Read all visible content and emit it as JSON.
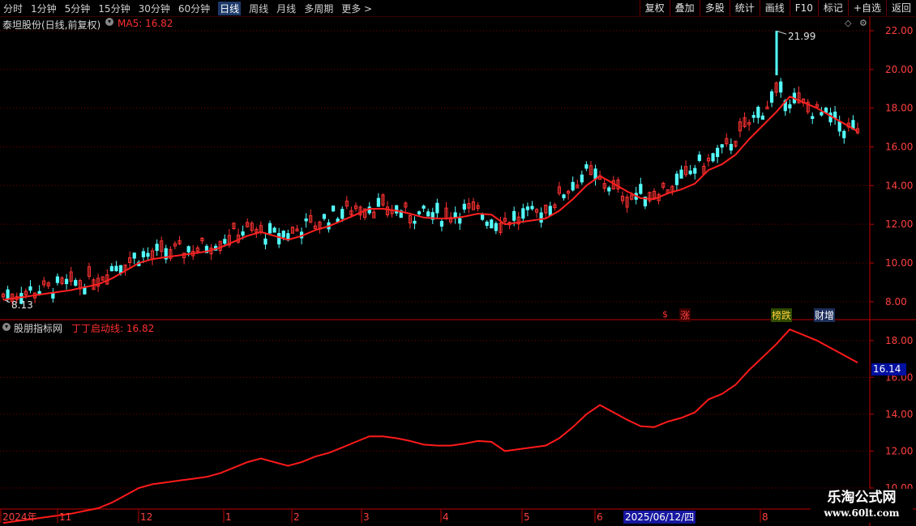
{
  "toolbar": {
    "periods": [
      {
        "label": "分时",
        "active": false
      },
      {
        "label": "1分钟",
        "active": false
      },
      {
        "label": "5分钟",
        "active": false
      },
      {
        "label": "15分钟",
        "active": false
      },
      {
        "label": "30分钟",
        "active": false
      },
      {
        "label": "60分钟",
        "active": false
      },
      {
        "label": "日线",
        "active": true
      },
      {
        "label": "周线",
        "active": false
      },
      {
        "label": "月线",
        "active": false
      },
      {
        "label": "多周期",
        "active": false
      },
      {
        "label": "更多",
        "active": false
      }
    ],
    "tools": [
      "复权",
      "叠加",
      "多股",
      "统计",
      "画线",
      "F10",
      "标记",
      "+自选",
      "返回"
    ]
  },
  "main_panel": {
    "title": "泰坦股份(日线,前复权)",
    "indicator_name": "MA5:",
    "indicator_value": "16.82",
    "high_label": "21.99",
    "low_label": "8.13",
    "markers": [
      "$",
      "涨",
      "榜跌",
      "财增"
    ]
  },
  "sub_panel": {
    "title": "股朋指标网",
    "indicator_name": "丁丁启动线:",
    "indicator_value": "16.82",
    "current_value_box": "16.14"
  },
  "date_axis": {
    "labels": [
      "2024年",
      "11",
      "12",
      "1",
      "2",
      "3",
      "4",
      "5",
      "6",
      "8"
    ],
    "crosshair_label": "2025/06/12/四"
  },
  "watermark": {
    "line1": "乐淘公式网",
    "line2": "www.60lt.com"
  },
  "colors": {
    "up": "#ff3232",
    "down": "#54ffff",
    "ma": "#ff2020",
    "grid": "#7a0000",
    "axis_text": "#ff4040"
  },
  "chart_data": [
    {
      "type": "candlestick",
      "name": "main",
      "y_ticks": [
        8.0,
        10.0,
        12.0,
        14.0,
        16.0,
        18.0,
        20.0,
        22.0
      ],
      "ylim": [
        7.2,
        22.5
      ],
      "ma5_series": [
        8.1,
        8.2,
        8.3,
        8.4,
        8.5,
        8.6,
        8.75,
        8.9,
        9.2,
        9.6,
        10.0,
        10.2,
        10.3,
        10.4,
        10.5,
        10.6,
        10.8,
        11.1,
        11.4,
        11.6,
        11.4,
        11.2,
        11.4,
        11.7,
        11.9,
        12.2,
        12.5,
        12.8,
        12.8,
        12.7,
        12.55,
        12.35,
        12.3,
        12.3,
        12.4,
        12.55,
        12.5,
        12.0,
        12.1,
        12.2,
        12.3,
        12.7,
        13.3,
        14.0,
        14.5,
        14.1,
        13.7,
        13.35,
        13.3,
        13.6,
        13.8,
        14.1,
        14.8,
        15.1,
        15.6,
        16.4,
        17.1,
        17.8,
        18.6,
        18.3,
        18.0,
        17.6,
        17.2,
        16.8
      ]
    },
    {
      "type": "line",
      "name": "sub",
      "y_ticks": [
        10.0,
        12.0,
        14.0,
        16.0,
        18.0
      ],
      "ylim": [
        8.9,
        19.0
      ]
    }
  ]
}
